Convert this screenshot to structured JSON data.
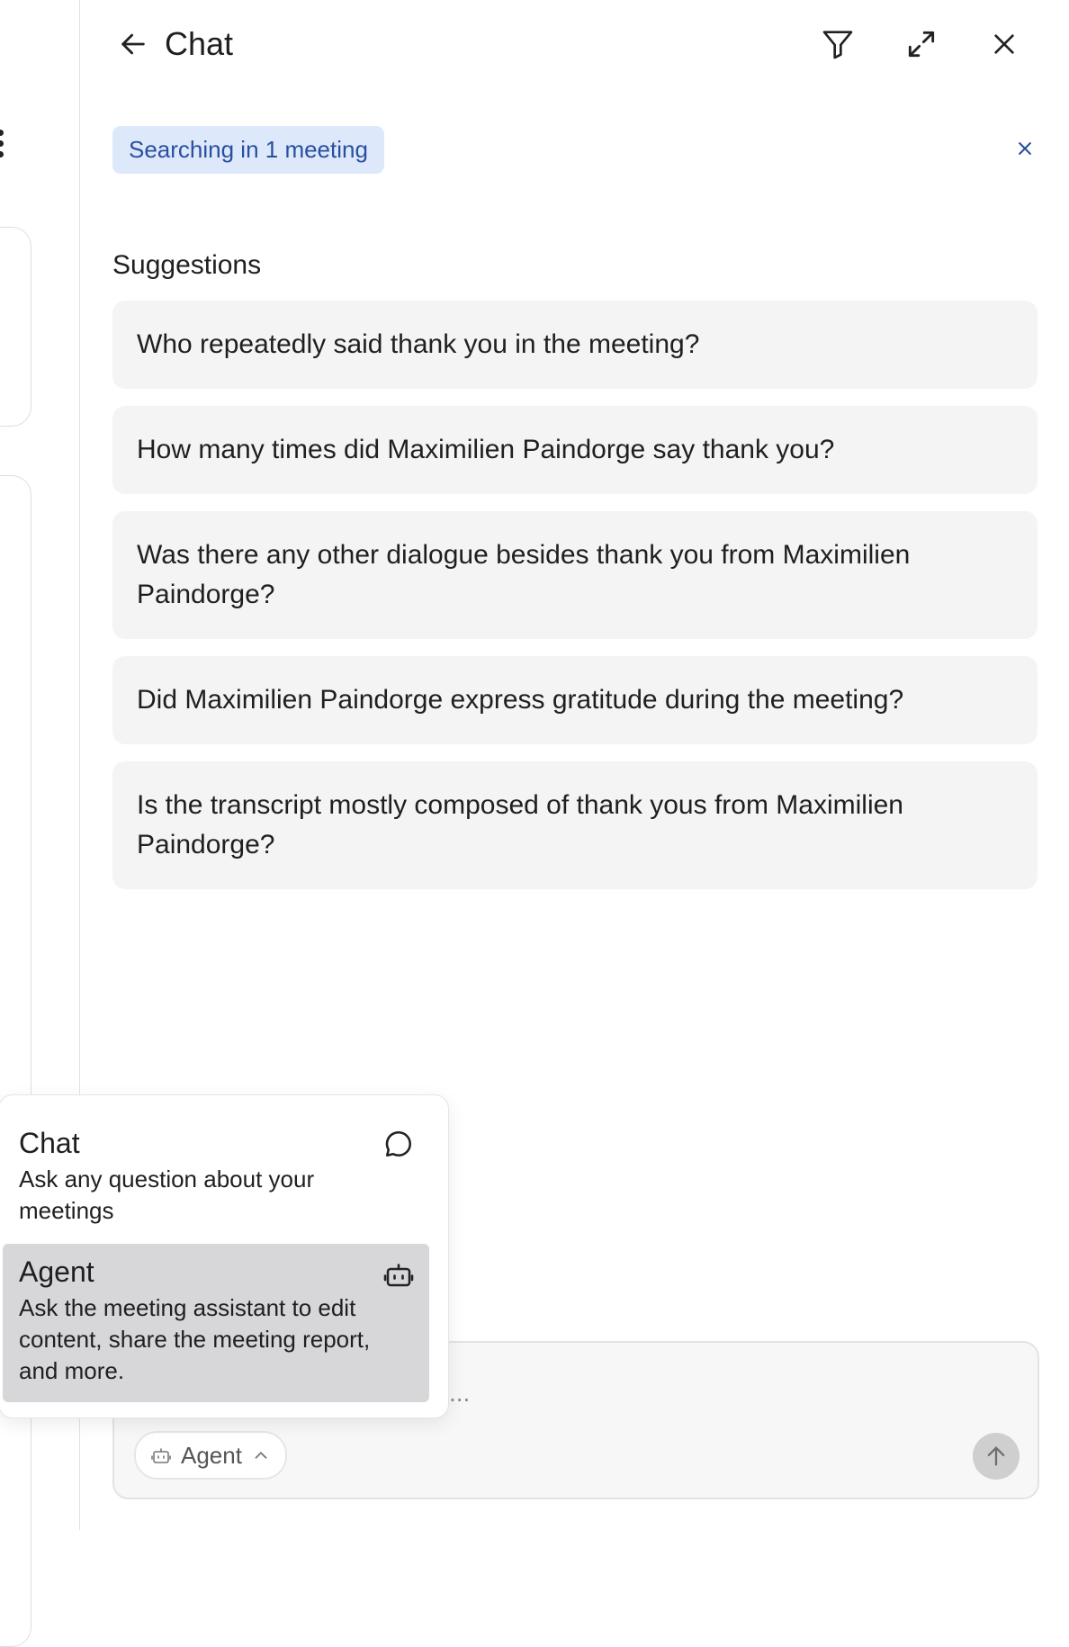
{
  "header": {
    "title": "Chat",
    "icons": {
      "back": "arrow-left-icon",
      "filter": "filter-icon",
      "expand": "expand-icon",
      "close": "close-icon"
    }
  },
  "scope": {
    "label": "Searching in 1 meeting"
  },
  "suggestions": {
    "heading": "Suggestions",
    "items": [
      "Who repeatedly said thank you in the meeting?",
      "How many times did Maximilien Paindorge say thank you?",
      "Was there any other dialogue besides thank you from Maximilien Paindorge?",
      "Did Maximilien Paindorge express gratitude during the meeting?",
      "Is the transcript mostly composed of thank yous from Maximilien Paindorge?"
    ]
  },
  "mode_menu": {
    "options": [
      {
        "title": "Chat",
        "description": "Ask any question about your meetings",
        "icon": "chat-bubble-icon",
        "selected": false
      },
      {
        "title": "Agent",
        "description": "Ask the meeting assistant to edit content, share the meeting report, and more.",
        "icon": "robot-icon",
        "selected": true
      }
    ]
  },
  "composer": {
    "placeholder_visible": "...",
    "mode_label": "Agent",
    "send_icon": "arrow-up-icon"
  },
  "colors": {
    "chip_bg": "#dde9fb",
    "chip_text": "#2a4fa0",
    "suggestion_bg": "#f4f4f5",
    "selected_option_bg": "#d7d7da"
  }
}
